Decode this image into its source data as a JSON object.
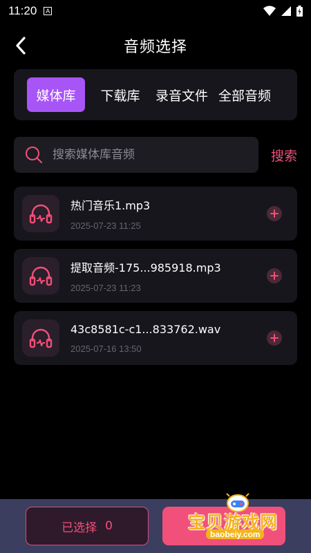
{
  "status_bar": {
    "time": "11:20",
    "a_icon": "A"
  },
  "header": {
    "title": "音频选择"
  },
  "tabs": [
    {
      "label": "媒体库"
    },
    {
      "label": "下载库"
    },
    {
      "label": "录音文件"
    },
    {
      "label": "全部音频"
    }
  ],
  "search": {
    "placeholder": "搜索媒体库音频",
    "value": "",
    "button_label": "搜索"
  },
  "files": [
    {
      "name": "热门音乐1.mp3",
      "date": "2025-07-23 11:25"
    },
    {
      "name": "提取音频-175...985918.mp3",
      "date": "2025-07-23 11:23"
    },
    {
      "name": "43c8581c-c1...833762.wav",
      "date": "2025-07-16 13:50"
    }
  ],
  "bottom": {
    "selected_label": "已选择",
    "selected_count": "0"
  },
  "watermark": {
    "text": "宝贝游戏网",
    "url": "baobeiy.com"
  },
  "colors": {
    "accent": "#a855f7",
    "pink": "#f0507a",
    "bottom_bar": "#3b3e5e",
    "card": "#17161c"
  },
  "icons": {
    "back": "chevron-left-icon",
    "search": "search-icon",
    "file": "headphones-icon",
    "add": "plus-icon"
  }
}
